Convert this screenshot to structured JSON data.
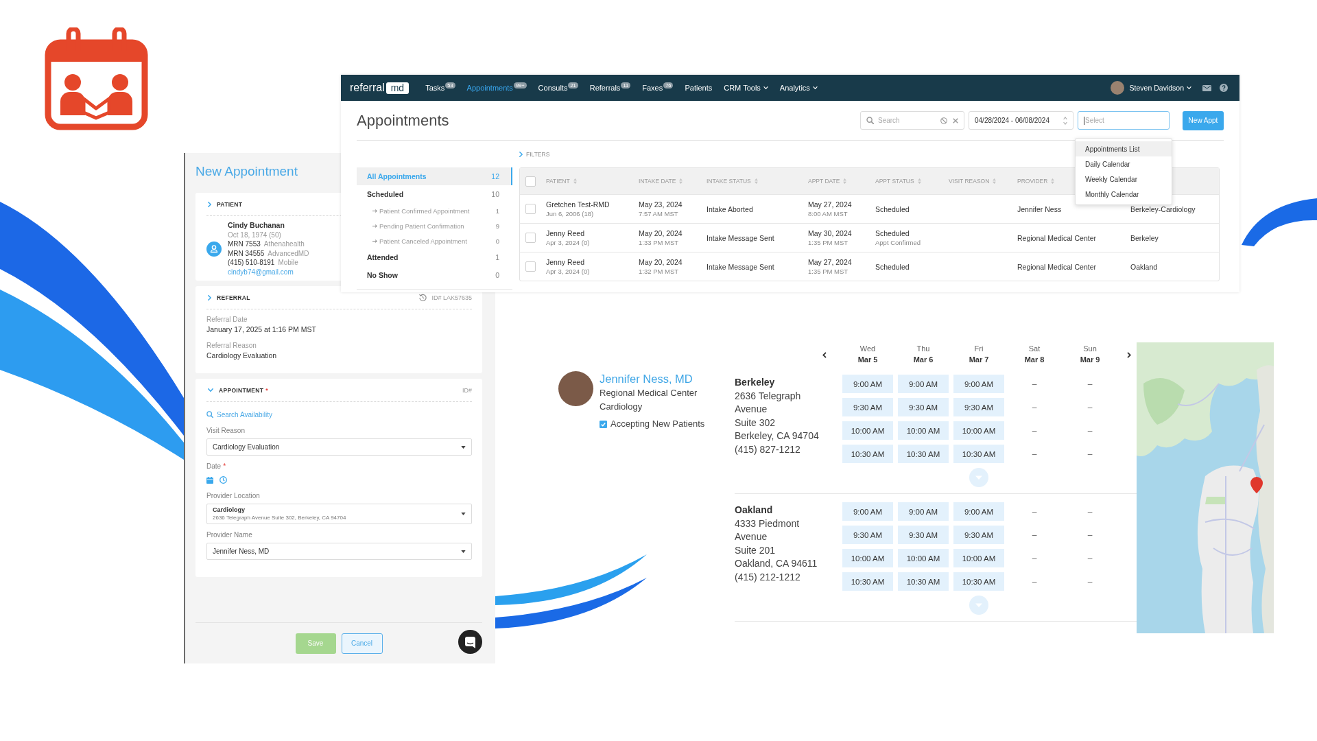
{
  "app_window": {
    "nav": {
      "brand": {
        "text": "referral",
        "mark": "md"
      },
      "items": [
        {
          "label": "Tasks",
          "badge": "53",
          "selected": false,
          "dropdown": false
        },
        {
          "label": "Appointments",
          "badge": "99+",
          "selected": true,
          "dropdown": false
        },
        {
          "label": "Consults",
          "badge": "21",
          "selected": false,
          "dropdown": false
        },
        {
          "label": "Referrals",
          "badge": "11",
          "selected": false,
          "dropdown": false
        },
        {
          "label": "Faxes",
          "badge": "76",
          "selected": false,
          "dropdown": false
        },
        {
          "label": "Patients",
          "selected": false,
          "dropdown": false
        },
        {
          "label": "CRM Tools",
          "selected": false,
          "dropdown": true
        },
        {
          "label": "Analytics",
          "selected": false,
          "dropdown": true
        }
      ],
      "user": {
        "name": "Steven Davidson"
      }
    },
    "title": "Appointments",
    "search": {
      "placeholder": "Search"
    },
    "date_range": {
      "value": "04/28/2024 - 06/08/2024"
    },
    "view_select": {
      "placeholder": "Select",
      "focused": true,
      "options": [
        {
          "label": "Appointments List",
          "selected": true
        },
        {
          "label": "Daily Calendar",
          "selected": false
        },
        {
          "label": "Weekly Calendar",
          "selected": false
        },
        {
          "label": "Monthly Calendar",
          "selected": false
        }
      ]
    },
    "new_button": "New Appt",
    "filters": {
      "label": "FILTERS",
      "expanded": false
    },
    "status_list": [
      {
        "label": "All Appointments",
        "count": "12",
        "selected": true
      },
      {
        "label": "Scheduled",
        "count": "10",
        "selected": false,
        "children": [
          {
            "label": "Patient Confirmed Appointment",
            "count": "1",
            "selected": false
          },
          {
            "label": "Pending Patient Confirmation",
            "count": "9",
            "selected": false
          },
          {
            "label": "Patient Canceled Appointment",
            "count": "0",
            "selected": false
          }
        ]
      },
      {
        "label": "Attended",
        "count": "1",
        "selected": false
      },
      {
        "label": "No Show",
        "count": "0",
        "selected": false
      }
    ],
    "table": {
      "select_all_checked": false,
      "columns": [
        {
          "label": "PATIENT"
        },
        {
          "label": "INTAKE DATE"
        },
        {
          "label": "INTAKE STATUS"
        },
        {
          "label": "APPT DATE"
        },
        {
          "label": "APPT STATUS"
        },
        {
          "label": "VISIT REASON"
        },
        {
          "label": "PROVIDER"
        }
      ],
      "rows": [
        {
          "checked": false,
          "patient": "Gretchen Test-RMD",
          "patient_dob": "Jun 6, 2006 (18)",
          "intake_date": "May 23, 2024",
          "intake_time": "7:57 AM MST",
          "intake_status": "Intake Aborted",
          "appt_date": "May 27, 2024",
          "appt_time": "8:00 AM MST",
          "appt_status": "Scheduled",
          "provider": "Jennifer Ness",
          "column_9": "Berkeley-Cardiology"
        },
        {
          "checked": false,
          "patient": "Jenny Reed",
          "patient_dob": "Apr 3, 2024 (0)",
          "intake_date": "May 20, 2024",
          "intake_time": "1:33 PM MST",
          "intake_status": "Intake Message Sent",
          "appt_date": "May 30, 2024",
          "appt_time": "1:35 PM MST",
          "appt_status": "Scheduled",
          "appt_status_note": "Appt Confirmed",
          "provider": "Regional Medical Center",
          "column_9": "Berkeley"
        },
        {
          "checked": false,
          "patient": "Jenny Reed",
          "patient_dob": "Apr 3, 2024 (0)",
          "intake_date": "May 20, 2024",
          "intake_time": "1:32 PM MST",
          "intake_status": "Intake Message Sent",
          "appt_date": "May 27, 2024",
          "appt_time": "1:35 PM MST",
          "appt_status": "Scheduled",
          "provider": "Regional Medical Center",
          "column_9": "Oakland"
        }
      ]
    }
  },
  "new_appointment": {
    "title": "New Appointment",
    "patient": {
      "heading": "PATIENT",
      "expanded": false,
      "name": "Cindy Buchanan",
      "dob": "Oct 18, 1974 (50)",
      "identifiers": [
        {
          "value": "MRN 7553",
          "source": "Athenahealth"
        },
        {
          "value": "MRN 34555",
          "source": "AdvancedMD"
        },
        {
          "value": "(415) 510-8191",
          "source": "Mobile"
        }
      ],
      "email": "cindyb74@gmail.com"
    },
    "referral": {
      "heading": "REFERRAL",
      "expanded": false,
      "id": "ID# LAK57635",
      "fields": [
        {
          "label": "Referral Date",
          "value": "January 17, 2025 at 1:16 PM MST"
        },
        {
          "label": "Referral Reason",
          "value": "Cardiology Evaluation"
        }
      ]
    },
    "appointment": {
      "heading": "APPOINTMENT",
      "required_mark": "*",
      "expanded": true,
      "id": "ID#",
      "search_link": "Search Availability",
      "fields": [
        {
          "kind": "select",
          "label": "Visit Reason",
          "value": "Cardiology Evaluation"
        },
        {
          "kind": "datetime",
          "label": "Date",
          "required_mark": "*"
        },
        {
          "kind": "select",
          "label": "Provider Location",
          "value": "Cardiology",
          "detail": "2636 Telegraph Avenue Suite 302, Berkeley, CA 94704"
        },
        {
          "kind": "select",
          "label": "Provider Name",
          "value": "Jennifer Ness, MD"
        }
      ]
    },
    "buttons": [
      {
        "label": "Save",
        "kind": "save",
        "disabled": true
      },
      {
        "label": "Cancel",
        "kind": "cancel",
        "disabled": false
      }
    ]
  },
  "availability": {
    "provider": {
      "name": "Jennifer Ness, MD",
      "organization": "Regional Medical Center",
      "specialty": "Cardiology",
      "accepting": {
        "label": "Accepting New Patients",
        "checked": true
      }
    },
    "days": [
      {
        "weekday": "Wed",
        "date": "Mar 5"
      },
      {
        "weekday": "Thu",
        "date": "Mar 6"
      },
      {
        "weekday": "Fri",
        "date": "Mar 7"
      },
      {
        "weekday": "Sat",
        "date": "Mar 8"
      },
      {
        "weekday": "Sun",
        "date": "Mar 9"
      }
    ],
    "locations": [
      {
        "name": "Berkeley",
        "street": "2636 Telegraph Avenue",
        "suite": "Suite 302",
        "city": "Berkeley, CA 94704",
        "phone": "(415) 827-1212",
        "day_slots": [
          {
            "slots": [
              {
                "kind": "slot",
                "label": "9:00 AM"
              },
              {
                "kind": "slot",
                "label": "9:30 AM"
              },
              {
                "kind": "slot",
                "label": "10:00 AM"
              },
              {
                "kind": "slot",
                "label": "10:30 AM"
              }
            ]
          },
          {
            "slots": [
              {
                "kind": "slot",
                "label": "9:00 AM"
              },
              {
                "kind": "slot",
                "label": "9:30 AM"
              },
              {
                "kind": "slot",
                "label": "10:00 AM"
              },
              {
                "kind": "slot",
                "label": "10:30 AM"
              }
            ]
          },
          {
            "slots": [
              {
                "kind": "slot",
                "label": "9:00 AM"
              },
              {
                "kind": "slot",
                "label": "9:30 AM"
              },
              {
                "kind": "slot",
                "label": "10:00 AM"
              },
              {
                "kind": "slot",
                "label": "10:30 AM"
              }
            ]
          },
          {
            "slots": [
              {
                "kind": "none",
                "label": "–"
              },
              {
                "kind": "none",
                "label": "–"
              },
              {
                "kind": "none",
                "label": "–"
              },
              {
                "kind": "none",
                "label": "–"
              }
            ]
          },
          {
            "slots": [
              {
                "kind": "none",
                "label": "–"
              },
              {
                "kind": "none",
                "label": "–"
              },
              {
                "kind": "none",
                "label": "–"
              },
              {
                "kind": "none",
                "label": "–"
              }
            ]
          }
        ]
      },
      {
        "name": "Oakland",
        "street": "4333 Piedmont Avenue",
        "suite": "Suite 201",
        "city": "Oakland, CA 94611",
        "phone": "(415) 212-1212",
        "day_slots": [
          {
            "slots": [
              {
                "kind": "slot",
                "label": "9:00 AM"
              },
              {
                "kind": "slot",
                "label": "9:30 AM"
              },
              {
                "kind": "slot",
                "label": "10:00 AM"
              },
              {
                "kind": "slot",
                "label": "10:30 AM"
              }
            ]
          },
          {
            "slots": [
              {
                "kind": "slot",
                "label": "9:00 AM"
              },
              {
                "kind": "slot",
                "label": "9:30 AM"
              },
              {
                "kind": "slot",
                "label": "10:00 AM"
              },
              {
                "kind": "slot",
                "label": "10:30 AM"
              }
            ]
          },
          {
            "slots": [
              {
                "kind": "slot",
                "label": "9:00 AM"
              },
              {
                "kind": "slot",
                "label": "9:30 AM"
              },
              {
                "kind": "slot",
                "label": "10:00 AM"
              },
              {
                "kind": "slot",
                "label": "10:30 AM"
              }
            ]
          },
          {
            "slots": [
              {
                "kind": "none",
                "label": "–"
              },
              {
                "kind": "none",
                "label": "–"
              },
              {
                "kind": "none",
                "label": "–"
              },
              {
                "kind": "none",
                "label": "–"
              }
            ]
          },
          {
            "slots": [
              {
                "kind": "none",
                "label": "–"
              },
              {
                "kind": "none",
                "label": "–"
              },
              {
                "kind": "none",
                "label": "–"
              },
              {
                "kind": "none",
                "label": "–"
              }
            ]
          }
        ]
      }
    ]
  }
}
